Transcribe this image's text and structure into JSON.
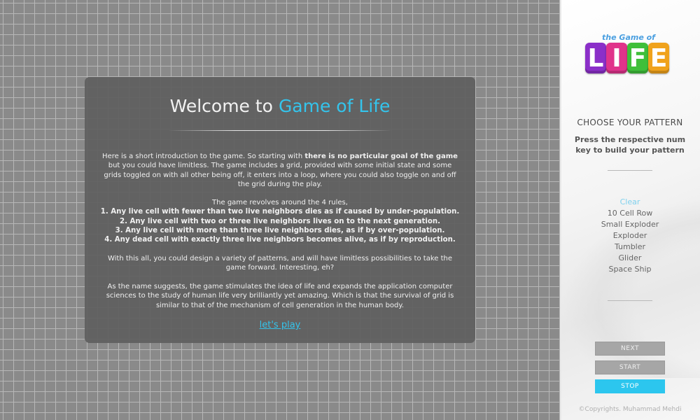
{
  "logo": {
    "top_text": "the Game of",
    "letters": [
      "L",
      "I",
      "F",
      "E"
    ]
  },
  "sidebar": {
    "title": "CHOOSE YOUR PATTERN",
    "subtitle": "Press the respective num key to build your pattern",
    "patterns": [
      "Clear",
      "10 Cell Row",
      "Small Exploder",
      "Exploder",
      "Tumbler",
      "Glider",
      "Space Ship"
    ],
    "active_pattern": "Clear",
    "buttons": {
      "next": "NEXT",
      "start": "START",
      "stop": "STOP"
    },
    "copyright": "©Copyrights. Muhammad Mehdi"
  },
  "modal": {
    "title_prefix": "Welcome to ",
    "title_accent": "Game of Life",
    "intro_part1": "Here is a short introduction to the game. So starting with ",
    "intro_bold": "there is no particular goal of the game",
    "intro_part2": " but you could have limitless. The game includes a grid, provided with some initial state and some grids toggled on with all other being off, it enters into a loop, where you could also toggle on and off the grid during the play.",
    "rules_intro": "The game revolves around the 4 rules,",
    "rules": [
      "1. Any live cell with fewer than two live neighbors dies as if caused by under-population.",
      "2. Any live cell with two or three live neighbors lives on to the next generation.",
      "3. Any live cell with more than three live neighbors dies, as if by over-population.",
      "4. Any dead cell with exactly three live neighbors becomes alive, as if by reproduction."
    ],
    "paragraph3": "With this all, you could design a variety of patterns, and will have limitless possibilities to take the game forward. Interesting, eh?",
    "paragraph4": "As the name suggests, the game stimulates the idea of life and expands the application computer sciences to the study of human life very brilliantly yet amazing. Which is that the survival of grid is similar to that of the mechanism of cell generation in the human body.",
    "cta": "let's play"
  },
  "colors": {
    "accent": "#34c4ec",
    "stop_button": "#2cc6ee",
    "grid_cell": "#8f8f8f",
    "grid_line": "#bdbdbd"
  }
}
